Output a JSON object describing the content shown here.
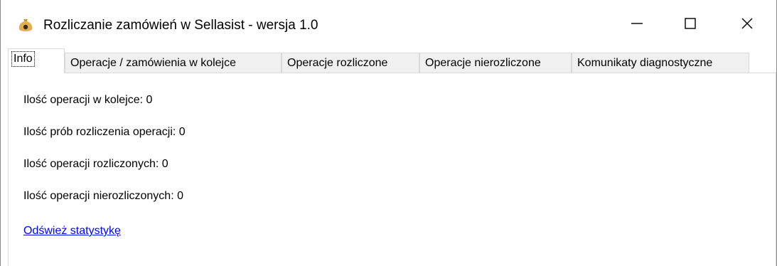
{
  "window": {
    "title": "Rozliczanie zamówień w Sellasist - wersja 1.0",
    "icon": "money-bag-icon",
    "controls": {
      "minimize": "minimize-icon",
      "maximize": "maximize-icon",
      "close": "close-icon"
    }
  },
  "tabs": [
    {
      "label": "Info",
      "active": true
    },
    {
      "label": "Operacje / zamówienia w kolejce",
      "active": false
    },
    {
      "label": "Operacje rozliczone",
      "active": false
    },
    {
      "label": "Operacje nierozliczone",
      "active": false
    },
    {
      "label": "Komunikaty diagnostyczne",
      "active": false
    }
  ],
  "info": {
    "stats": [
      "Ilość operacji w kolejce: 0",
      "Ilość prób rozliczenia operacji: 0",
      "Ilość operacji rozliczonych: 0",
      "Ilość operacji nierozliczonych: 0"
    ],
    "refresh_link": "Odśwież statystykę"
  },
  "colors": {
    "link": "#0000ff",
    "icon_bag": "#d9a63a",
    "tab_inactive_bg": "#f0f0f0",
    "border": "#d9d9d9"
  }
}
